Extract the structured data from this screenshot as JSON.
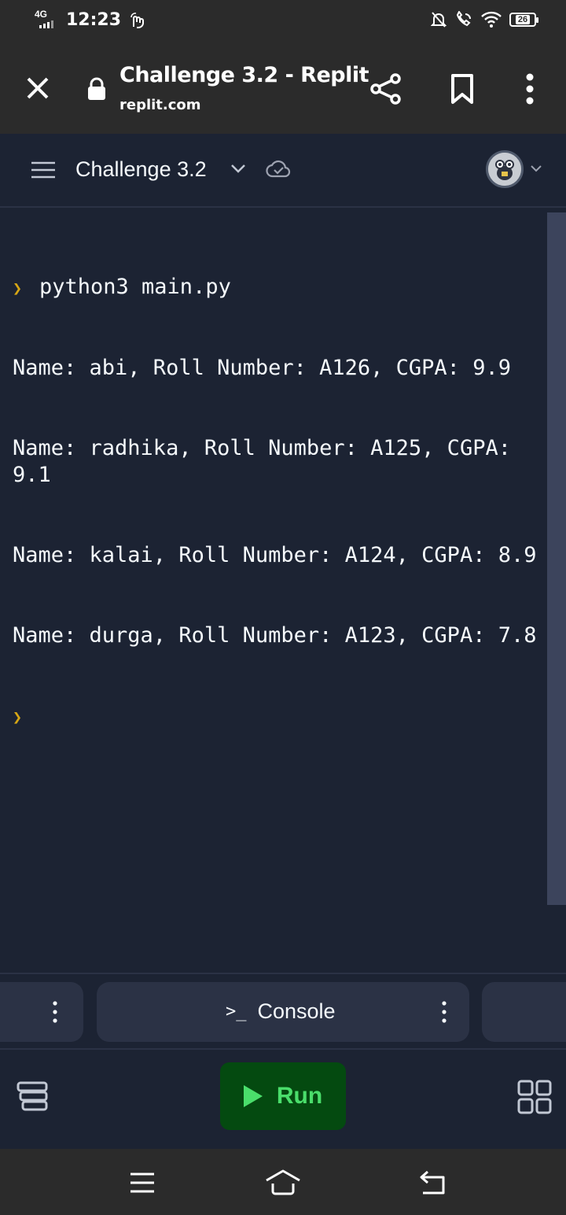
{
  "status_bar": {
    "network": "4G",
    "time": "12:23",
    "battery": "26"
  },
  "browser": {
    "title": "Challenge 3.2 - Replit",
    "url": "replit.com"
  },
  "header": {
    "repl_name": "Challenge 3.2"
  },
  "console": {
    "command": "python3 main.py",
    "output_lines": [
      "Name: abi, Roll Number: A126, CGPA: 9.9",
      "Name: radhika, Roll Number: A125, CGPA: 9.1",
      "Name: kalai, Roll Number: A124, CGPA: 8.9",
      "Name: durga, Roll Number: A123, CGPA: 7.8"
    ]
  },
  "panes": {
    "active_label": "Console"
  },
  "actions": {
    "run_label": "Run"
  },
  "colors": {
    "background": "#1c2333",
    "run_background": "#044a10",
    "run_accent": "#4ade6b",
    "prompt": "#d6a615"
  },
  "icons": [
    "close-icon",
    "lock-icon",
    "share-icon",
    "bookmark-icon",
    "more-vertical-icon",
    "hamburger-icon",
    "chevron-down-icon",
    "cloud-check-icon",
    "avatar",
    "terminal-icon",
    "play-icon",
    "files-icon",
    "grid-icon",
    "nav-menu-icon",
    "nav-home-icon",
    "nav-back-icon"
  ]
}
